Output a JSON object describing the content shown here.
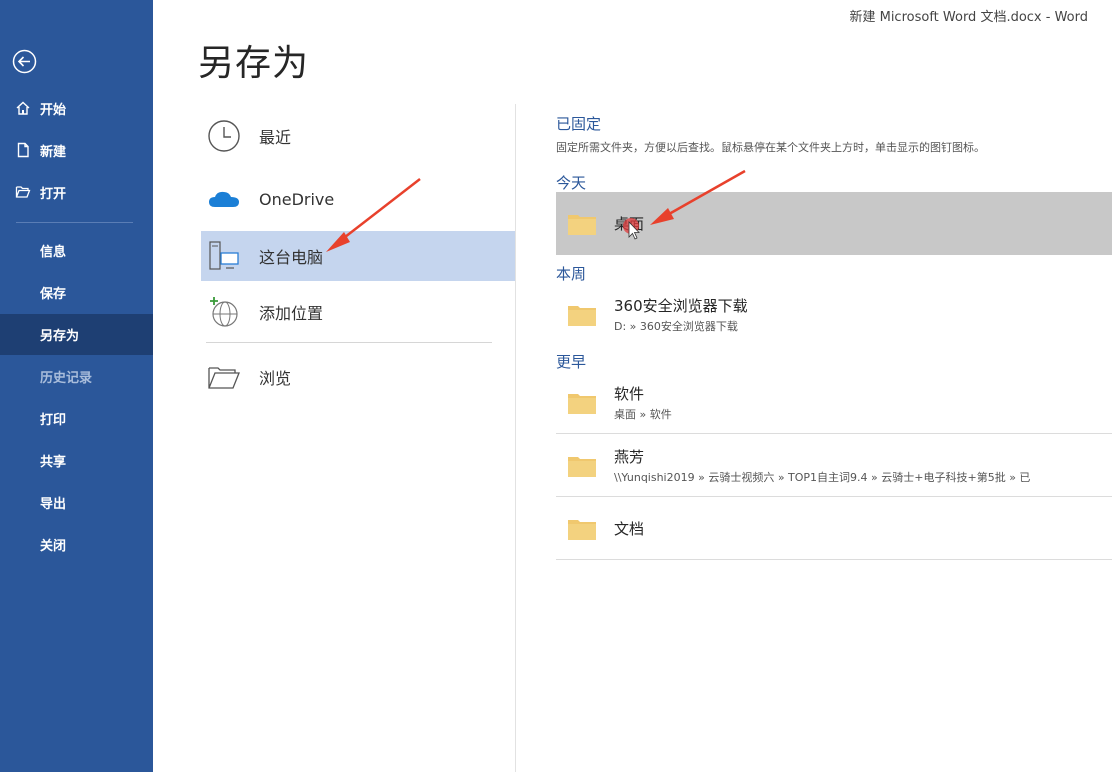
{
  "window": {
    "title": "新建 Microsoft Word 文档.docx  -  Word"
  },
  "sidebar": {
    "back_icon": "back-arrow-icon",
    "top_items": [
      {
        "label": "开始",
        "icon": "home-icon"
      },
      {
        "label": "新建",
        "icon": "new-document-icon"
      },
      {
        "label": "打开",
        "icon": "open-folder-icon"
      }
    ],
    "sub_items": [
      {
        "label": "信息"
      },
      {
        "label": "保存"
      },
      {
        "label": "另存为",
        "active": true
      },
      {
        "label": "历史记录",
        "disabled": true
      },
      {
        "label": "打印"
      },
      {
        "label": "共享"
      },
      {
        "label": "导出"
      },
      {
        "label": "关闭"
      }
    ],
    "colors": {
      "background": "#2b579a",
      "active": "#1e3f73"
    }
  },
  "page": {
    "title": "另存为"
  },
  "locations": [
    {
      "label": "最近",
      "icon": "clock-icon"
    },
    {
      "label": "OneDrive",
      "icon": "cloud-icon"
    },
    {
      "label": "这台电脑",
      "icon": "this-pc-icon",
      "selected": true
    },
    {
      "label": "添加位置",
      "icon": "add-location-globe-icon"
    },
    {
      "label": "浏览",
      "icon": "browse-folder-icon"
    }
  ],
  "right_pane": {
    "pinned": {
      "title": "已固定",
      "description": "固定所需文件夹，方便以后查找。鼠标悬停在某个文件夹上方时，单击显示的图钉图标。"
    },
    "groups": [
      {
        "title": "今天",
        "items": [
          {
            "name": "桌面",
            "path": "",
            "highlighted": true
          }
        ]
      },
      {
        "title": "本周",
        "items": [
          {
            "name": "360安全浏览器下载",
            "path": "D: » 360安全浏览器下载"
          }
        ]
      },
      {
        "title": "更早",
        "items": [
          {
            "name": "软件",
            "path": "桌面 » 软件"
          },
          {
            "name": "燕芳",
            "path": "\\\\Yunqishi2019 » 云骑士视频六 » TOP1自主词9.4 » 云骑士+电子科技+第5批 » 已"
          },
          {
            "name": "文档",
            "path": ""
          }
        ]
      }
    ]
  },
  "colors": {
    "accent": "#2b579a",
    "selected_location": "#c5d5ee",
    "hover_row": "#c8c8c8",
    "annotation_arrow": "#e8412c",
    "folder": "#f0c86e"
  }
}
